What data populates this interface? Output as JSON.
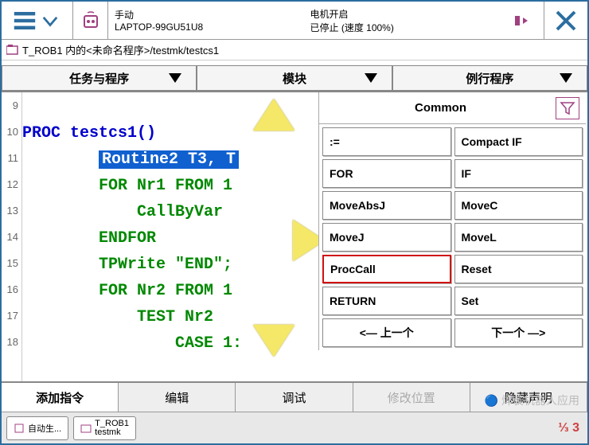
{
  "titlebar": {
    "mode": "手动",
    "host": "LAPTOP-99GU51U8",
    "motor": "电机开启",
    "status": "已停止 (速度 100%)"
  },
  "breadcrumb": "T_ROB1 内的<未命名程序>/testmk/testcs1",
  "tabs": {
    "t1": "任务与程序",
    "t2": "模块",
    "t3": "例行程序"
  },
  "code": {
    "lines": [
      "9",
      "10",
      "11",
      "12",
      "13",
      "14",
      "15",
      "16",
      "17",
      "18"
    ],
    "l10_proc": "PROC ",
    "l10_name": "testcs1()",
    "l11": "Routine2 T3, T",
    "l12": "FOR Nr1 FROM 1",
    "l13": "CallByVar",
    "l14": "ENDFOR",
    "l15": "TPWrite \"END\";",
    "l16": "FOR Nr2 FROM 1",
    "l17": "TEST Nr2",
    "l18": "CASE 1:"
  },
  "panel": {
    "title": "Common",
    "items": [
      ":=",
      "Compact IF",
      "FOR",
      "IF",
      "MoveAbsJ",
      "MoveC",
      "MoveJ",
      "MoveL",
      "ProcCall",
      "Reset",
      "RETURN",
      "Set"
    ],
    "prev": "<— 上一个",
    "next": "下一个 —>"
  },
  "bottom": {
    "b1": "添加指令",
    "b2": "编辑",
    "b3": "调试",
    "b4": "修改位置",
    "b5": "隐藏声明"
  },
  "taskbar": {
    "i1": "自动生...",
    "i2a": "T_ROB1",
    "i2b": "testmk"
  },
  "watermark": "焊装机器人应用",
  "corner": "3"
}
